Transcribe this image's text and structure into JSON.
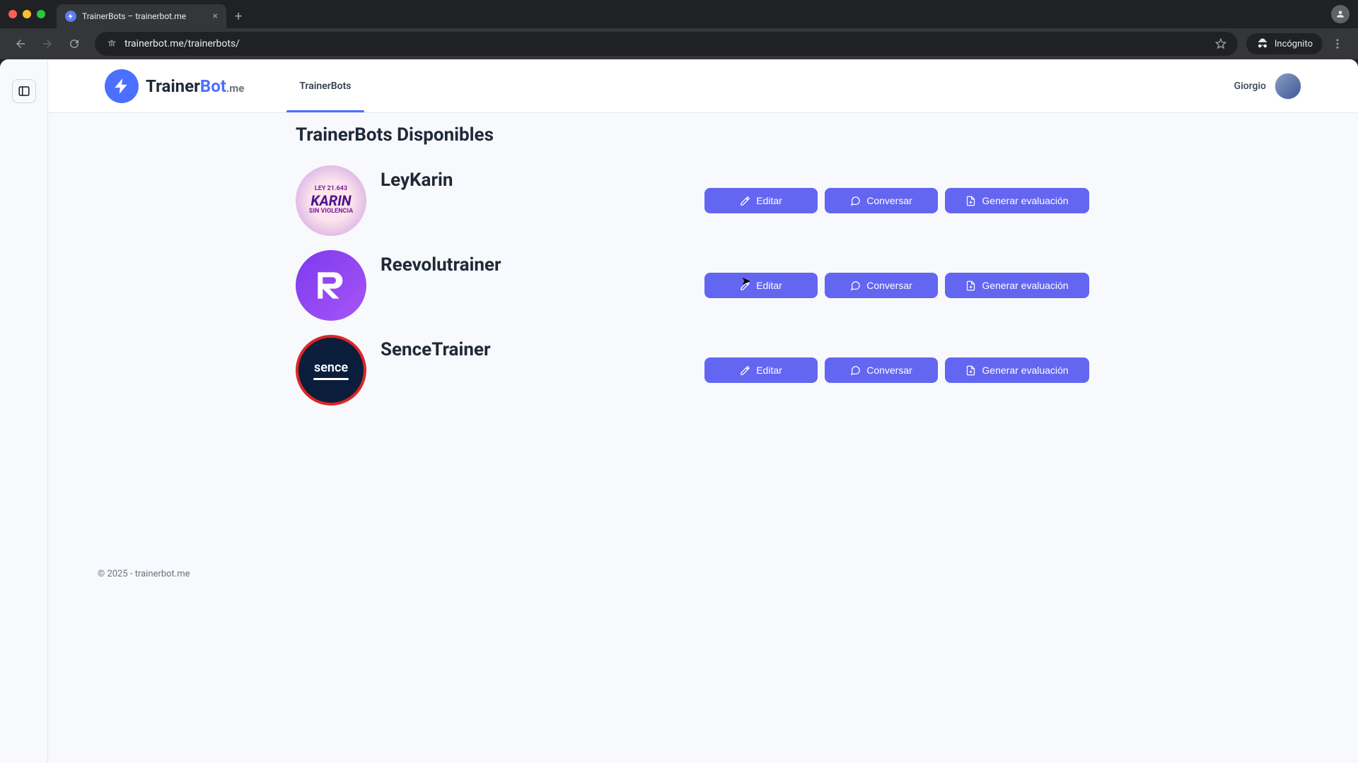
{
  "browser": {
    "tab_title": "TrainerBots – trainerbot.me",
    "url": "trainerbot.me/trainerbots/",
    "incognito_label": "Incógnito"
  },
  "header": {
    "logo_part1": "Trainer",
    "logo_part2": "Bot",
    "logo_suffix": ".me",
    "nav_tab": "TrainerBots",
    "user_name": "Giorgio"
  },
  "page": {
    "title": "TrainerBots Disponibles"
  },
  "bots": [
    {
      "name": "LeyKarin",
      "avatar_kind": "karin"
    },
    {
      "name": "Reevolutrainer",
      "avatar_kind": "reevo"
    },
    {
      "name": "SenceTrainer",
      "avatar_kind": "sence"
    }
  ],
  "actions": {
    "edit": "Editar",
    "chat": "Conversar",
    "eval": "Generar evaluación"
  },
  "avatar_labels": {
    "karin_top": "LEY 21.643",
    "karin_main": "KARIN",
    "karin_bottom": "SIN VIOLENCIA",
    "sence_text": "sence"
  },
  "footer": "© 2025 - trainerbot.me"
}
